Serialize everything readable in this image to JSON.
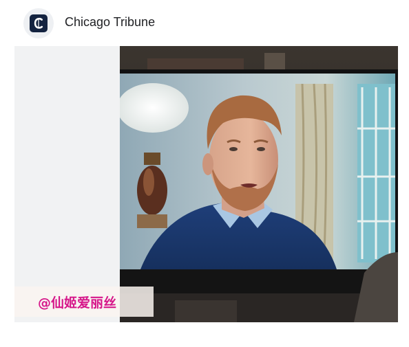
{
  "header": {
    "logo_icon": "chicago-tribune-gothic-c-logo",
    "source_name": "Chicago Tribune"
  },
  "media": {
    "watermark": "@仙姬爱丽丝"
  },
  "colors": {
    "logo_bg": "#142340",
    "watermark_text": "#d6178a"
  }
}
